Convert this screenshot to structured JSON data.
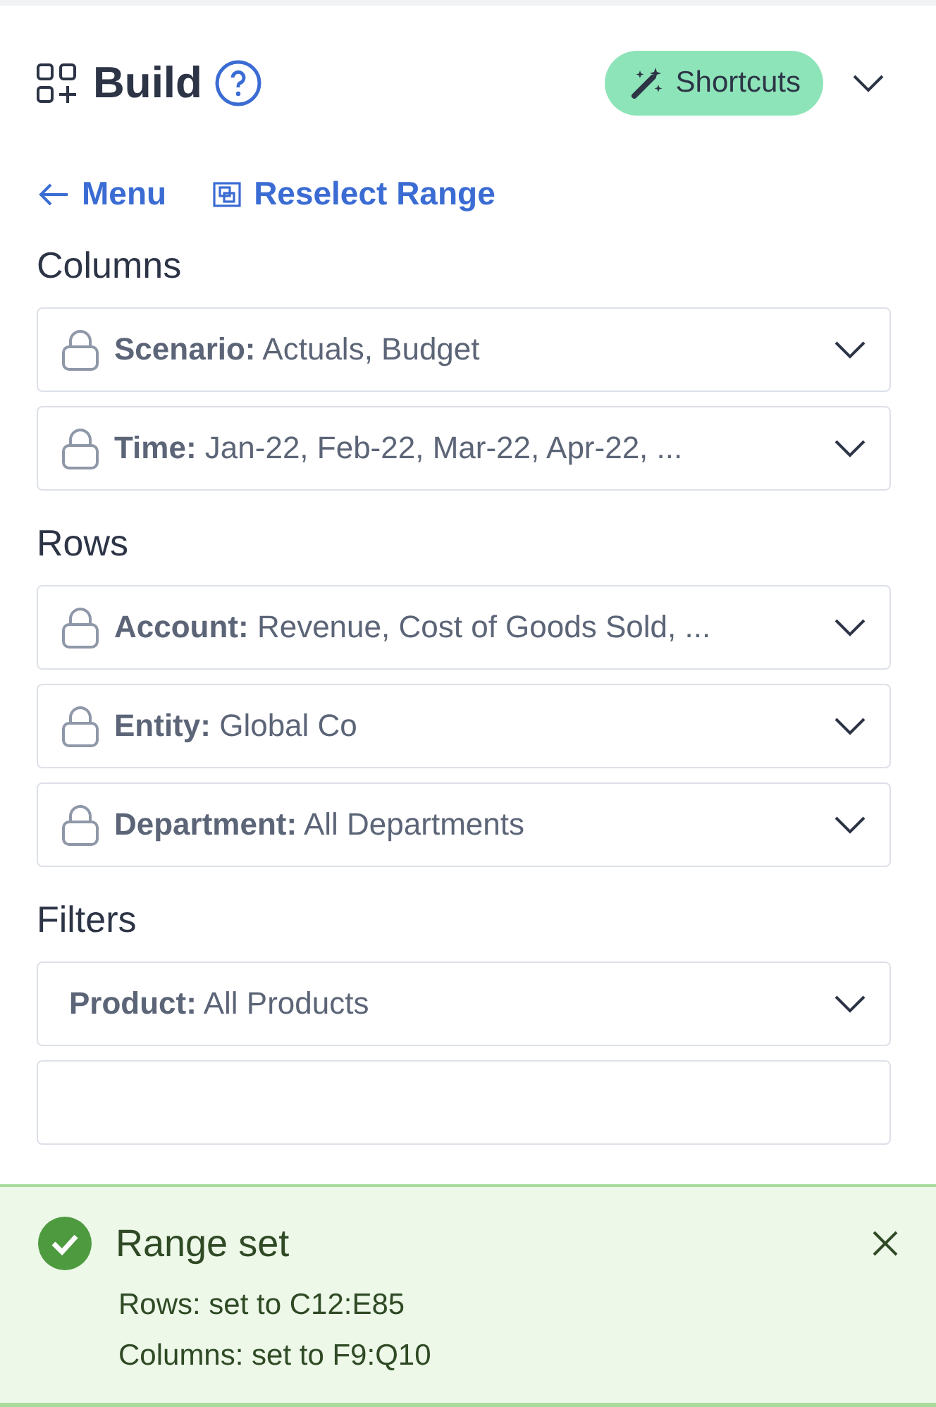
{
  "header": {
    "title": "Build",
    "shortcuts_button": "Shortcuts"
  },
  "links": [
    {
      "kind": "back",
      "label": "Menu"
    },
    {
      "kind": "reselect",
      "label": "Reselect Range"
    }
  ],
  "sections": [
    {
      "title": "Columns",
      "fields": [
        {
          "label": "Scenario:",
          "value": "Actuals, Budget",
          "locked": true
        },
        {
          "label": "Time:",
          "value": "Jan-22, Feb-22, Mar-22, Apr-22, ...",
          "locked": true
        }
      ]
    },
    {
      "title": "Rows",
      "fields": [
        {
          "label": "Account:",
          "value": "Revenue, Cost of Goods Sold, ...",
          "locked": true
        },
        {
          "label": "Entity:",
          "value": "Global Co",
          "locked": true
        },
        {
          "label": "Department:",
          "value": "All Departments",
          "locked": true
        }
      ]
    },
    {
      "title": "Filters",
      "fields": [
        {
          "label": "Product:",
          "value": "All Products",
          "locked": false
        }
      ]
    }
  ],
  "toast": {
    "title": "Range set",
    "lines": [
      "Rows: set to C12:E85",
      "Columns: set to F9:Q10"
    ]
  }
}
